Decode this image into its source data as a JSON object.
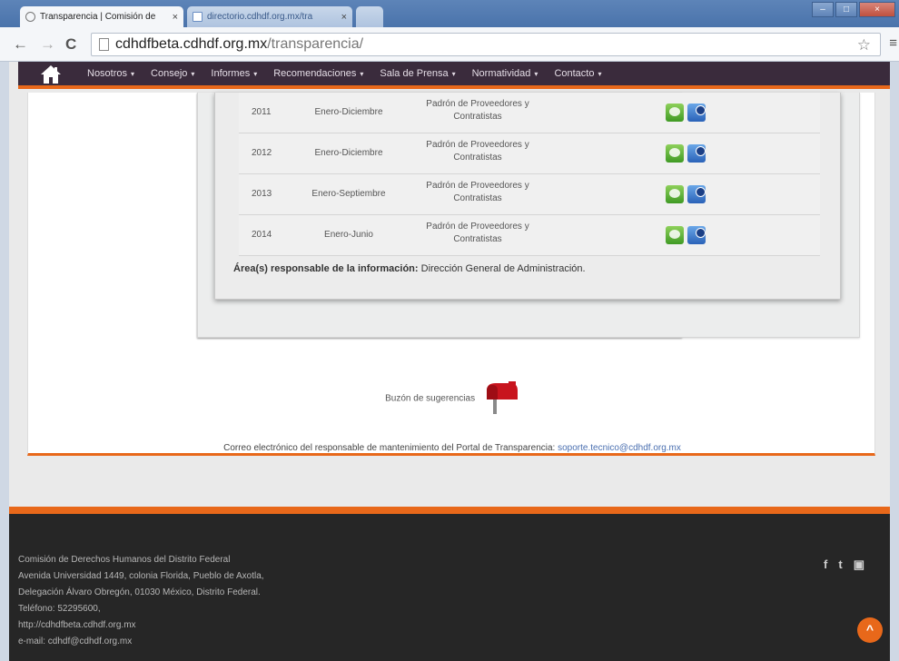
{
  "browser": {
    "tabs": [
      {
        "title": "Transparencia | Comisión de",
        "close": "×"
      },
      {
        "title": "directorio.cdhdf.org.mx/tra",
        "close": "×"
      }
    ],
    "url_domain": "cdhdfbeta.cdhdf.org.mx",
    "url_path": "/transparencia/",
    "nav": {
      "back": "←",
      "forward": "→",
      "reload": "C"
    },
    "star": "☆",
    "menu": "≡",
    "window_buttons": {
      "minimize": "–",
      "maximize": "□",
      "close": "×"
    }
  },
  "site_nav": {
    "items": [
      {
        "label": "Nosotros"
      },
      {
        "label": "Consejo"
      },
      {
        "label": "Informes"
      },
      {
        "label": "Recomendaciones"
      },
      {
        "label": "Sala de Prensa"
      },
      {
        "label": "Normatividad"
      },
      {
        "label": "Contacto"
      }
    ],
    "caret": "▾"
  },
  "records": [
    {
      "year": "2011",
      "period": "Enero-Diciembre",
      "doc_line1": "Padrón de Proveedores y",
      "doc_line2": "Contratistas"
    },
    {
      "year": "2012",
      "period": "Enero-Diciembre",
      "doc_line1": "Padrón de Proveedores y",
      "doc_line2": "Contratistas"
    },
    {
      "year": "2013",
      "period": "Enero-Septiembre",
      "doc_line1": "Padrón de Proveedores y",
      "doc_line2": "Contratistas"
    },
    {
      "year": "2014",
      "period": "Enero-Junio",
      "doc_line1": "Padrón de Proveedores y",
      "doc_line2": "Contratistas"
    }
  ],
  "responsible": {
    "label": "Área(s) responsable de la información:",
    "value": "Dirección General de Administración."
  },
  "suggestions": {
    "label": "Buzón de sugerencias"
  },
  "maintenance": {
    "text": "Correo electrónico del responsable de mantenimiento del Portal de Transparencia:",
    "email": "soporte.tecnico@cdhdf.org.mx"
  },
  "footer": {
    "lines": [
      "Comisión de Derechos Humanos del Distrito Federal",
      "Avenida Universidad 1449, colonia Florida, Pueblo de Axotla,",
      "Delegación Álvaro Obregón, 01030 México, Distrito Federal.",
      "Teléfono: 52295600,",
      "http://cdhdfbeta.cdhdf.org.mx",
      "e-mail: cdhdf@cdhdf.org.mx"
    ],
    "social": {
      "facebook": "f",
      "twitter": "t",
      "youtube": "▣"
    },
    "to_top": "^"
  },
  "colors": {
    "accent": "#e8681a",
    "nav_bg": "#3a2b3c",
    "footer_bg": "#262626"
  }
}
